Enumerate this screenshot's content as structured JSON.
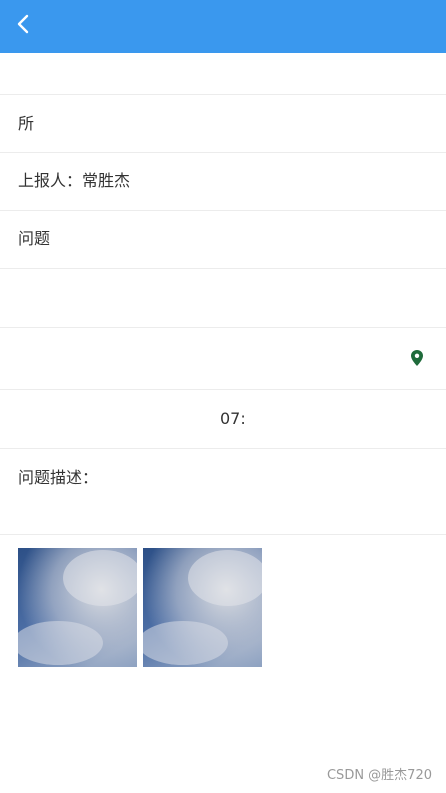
{
  "header": {
    "title": ""
  },
  "rows": [
    {
      "label": ""
    },
    {
      "label": "所"
    },
    {
      "label": "上报人：常胜杰"
    },
    {
      "label": "问题"
    },
    {
      "label": ""
    },
    {
      "label": ""
    },
    {
      "label": "07:"
    },
    {
      "label": "问题描述："
    }
  ],
  "photos": [
    {
      "alt": "sky"
    },
    {
      "alt": "sky"
    }
  ],
  "watermark": "CSDN @胜杰720",
  "colors": {
    "header": "#3a98ee",
    "location_pin": "#1f6b3b"
  }
}
